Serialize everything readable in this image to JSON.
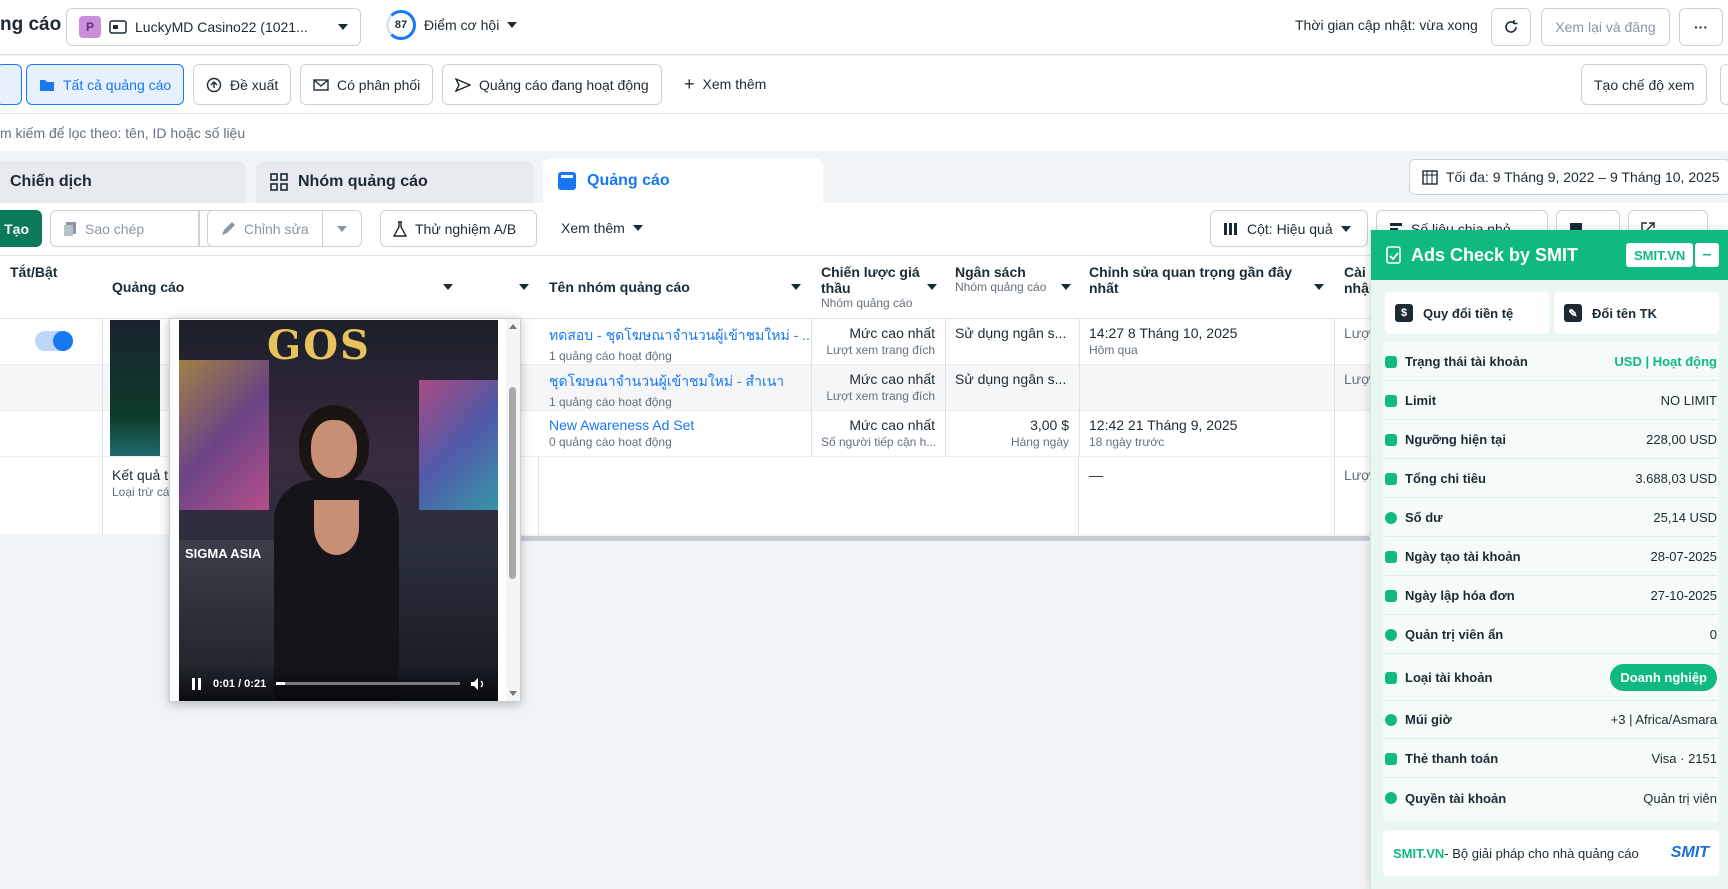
{
  "topbar": {
    "title_partial": "ng cáo",
    "account_letter": "P",
    "account_name": "LuckyMD Casino22 (1021...",
    "score": "87",
    "opportunity_label": "Điểm cơ hội",
    "update_status": "Thời gian cập nhật: vừa xong",
    "review_publish_label": "Xem lại và đăng",
    "more_label": "···"
  },
  "filters": {
    "all_ads": "Tất cả quảng cáo",
    "recommended": "Đề xuất",
    "has_delivery": "Có phân phối",
    "active_ads": "Quảng cáo đang hoạt động",
    "see_more": "Xem thêm",
    "create_view": "Tạo chế độ xem"
  },
  "search": {
    "placeholder": "m kiếm để lọc theo: tên, ID hoặc số liệu"
  },
  "tabs": {
    "campaigns": "Chiến dịch",
    "adsets": "Nhóm quảng cáo",
    "ads": "Quảng cáo",
    "date_range": "Tối đa: 9 Tháng 9, 2022 – 9 Tháng 10, 2025"
  },
  "toolbar": {
    "create": "Tạo",
    "duplicate": "Sao chép",
    "edit": "Chỉnh sửa",
    "ab_test": "Thử nghiệm A/B",
    "see_more": "Xem thêm",
    "columns": "Cột: Hiệu quả",
    "breakdown": "Số liệu chia nhỏ"
  },
  "table": {
    "headers": {
      "toggle": "Tắt/Bật",
      "ad": "Quảng cáo",
      "adset_name": "Tên nhóm quảng cáo",
      "bid_strategy": "Chiến lược giá thầu",
      "bid_strategy_sub": "Nhóm quảng cáo",
      "budget": "Ngân sách",
      "budget_sub": "Nhóm quảng cáo",
      "last_edit": "Chỉnh sửa quan trọng gần đây nhất",
      "settings_partial": "Cài nhận"
    },
    "rows": [
      {
        "adset": "ทดสอบ - ชุดโฆษณาจำนวนผู้เข้าชมใหม่ - ...",
        "adset_sub": "1 quảng cáo hoạt động",
        "bid": "Mức cao nhất",
        "bid_sub": "Lượt xem trang đích",
        "budget": "Sử dụng ngân s...",
        "budget_sub": "",
        "edit": "14:27 8 Tháng 10, 2025",
        "edit_sub": "Hôm qua",
        "extra": "Lượt"
      },
      {
        "adset": "ชุดโฆษณาจำนวนผู้เข้าชมใหม่ - สำเนา",
        "adset_sub": "1 quảng cáo hoạt động",
        "bid": "Mức cao nhất",
        "bid_sub": "Lượt xem trang đích",
        "budget": "Sử dụng ngân s...",
        "budget_sub": "",
        "edit": "",
        "edit_sub": "",
        "extra": "Lượt"
      },
      {
        "adset": "New Awareness Ad Set",
        "adset_sub": "0 quảng cáo hoạt động",
        "bid": "Mức cao nhất",
        "bid_sub": "Số người tiếp cận h...",
        "budget": "3,00 $",
        "budget_sub": "Hàng ngày",
        "edit": "12:42 21 Tháng 9, 2025",
        "edit_sub": "18 ngày trước",
        "extra": ""
      }
    ],
    "summary": {
      "label": "Kết quả t",
      "sub": "Loại trừ cá",
      "edit": "—",
      "extra": "Lượt"
    }
  },
  "video": {
    "time": "0:01 / 0:21",
    "sign_text": "SIGMA ASIA",
    "logo_text": "GOS"
  },
  "smit": {
    "title": "Ads Check by SMIT",
    "badge": "SMIT.VN",
    "minimize": "–",
    "convert_currency": "Quy đổi tiền tệ",
    "rename": "Đổi tên TK",
    "rows": [
      {
        "label": "Trạng thái tài khoản",
        "value": "USD | Hoạt động"
      },
      {
        "label": "Limit",
        "value": "NO LIMIT"
      },
      {
        "label": "Ngưỡng hiện tại",
        "value": "228,00 USD"
      },
      {
        "label": "Tổng chi tiêu",
        "value": "3.688,03 USD"
      },
      {
        "label": "Số dư",
        "value": "25,14 USD"
      },
      {
        "label": "Ngày tạo tài khoản",
        "value": "28-07-2025"
      },
      {
        "label": "Ngày lập hóa đơn",
        "value": "27-10-2025"
      },
      {
        "label": "Quản trị viên ẩn",
        "value": "0"
      },
      {
        "label": "Loại tài khoản",
        "value": "Doanh nghiệp"
      },
      {
        "label": "Múi giờ",
        "value": "+3 | Africa/Asmara"
      },
      {
        "label": "Thẻ thanh toán",
        "value": "Visa · 2151"
      },
      {
        "label": "Quyền tài khoản",
        "value": "Quản trị viên"
      }
    ],
    "footer_brand": "SMIT.VN",
    "footer_text": " - Bộ giải pháp cho nhà quảng cáo",
    "footer_logo": "SMIT"
  },
  "colors": {
    "accent": "#1877f2",
    "smit_green": "#10b981",
    "dark_green_button": "#0a7a5a"
  }
}
